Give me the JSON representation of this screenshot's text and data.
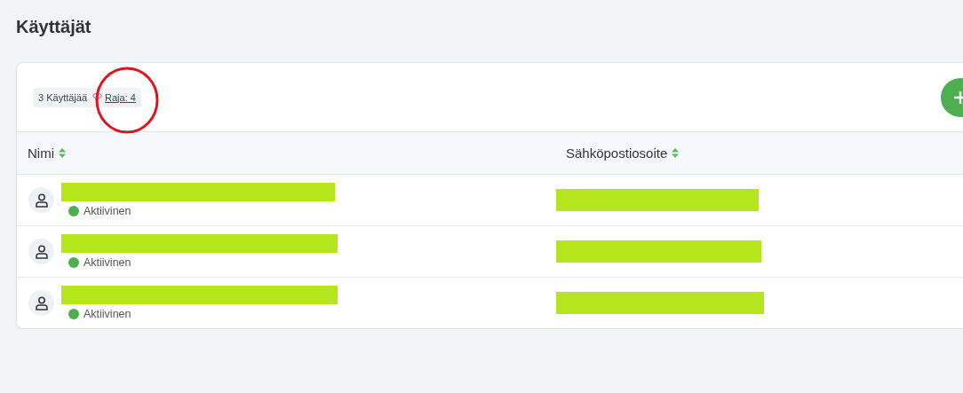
{
  "page": {
    "title": "Käyttäjät"
  },
  "toolbar": {
    "user_count": "3 Käyttäjää",
    "limit_link": "Raja: 4"
  },
  "table": {
    "columns": [
      {
        "label": "Nimi"
      },
      {
        "label": "Sähköpostiosoite"
      }
    ],
    "rows": [
      {
        "status": "Aktiivinen",
        "color": "#4caf50"
      },
      {
        "status": "Aktiivinen",
        "color": "#4caf50"
      },
      {
        "status": "Aktiivinen",
        "color": "#4caf50"
      }
    ]
  }
}
